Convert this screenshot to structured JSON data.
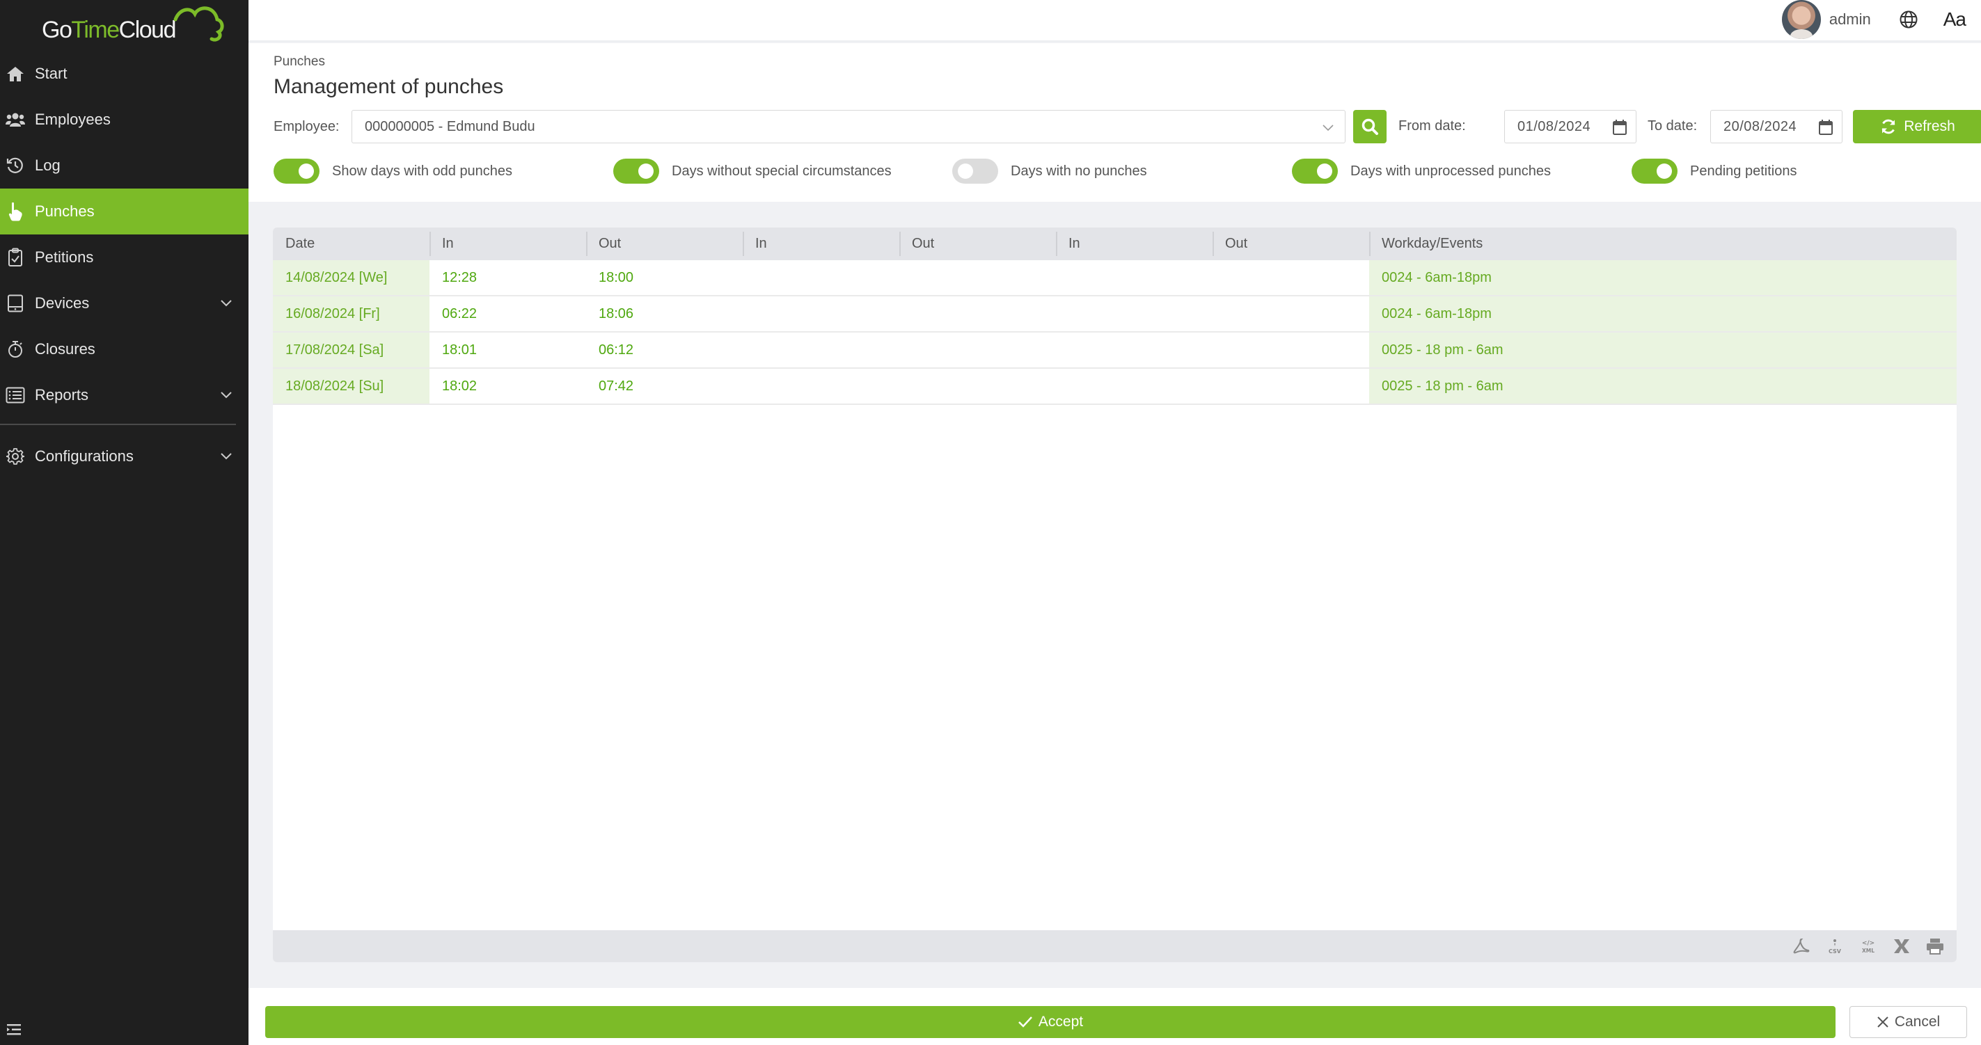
{
  "app": {
    "logo_part1": "Go",
    "logo_part2": "Time",
    "logo_part3": "Cloud",
    "brand_color": "#7cbb28"
  },
  "sidebar": {
    "items": [
      {
        "label": "Start",
        "icon": "home-icon",
        "active": false,
        "expandable": false
      },
      {
        "label": "Employees",
        "icon": "users-icon",
        "active": false,
        "expandable": false
      },
      {
        "label": "Log",
        "icon": "history-icon",
        "active": false,
        "expandable": false
      },
      {
        "label": "Punches",
        "icon": "hand-pointer-icon",
        "active": true,
        "expandable": false
      },
      {
        "label": "Petitions",
        "icon": "clipboard-check-icon",
        "active": false,
        "expandable": false
      },
      {
        "label": "Devices",
        "icon": "tablet-icon",
        "active": false,
        "expandable": true
      },
      {
        "label": "Closures",
        "icon": "stopwatch-icon",
        "active": false,
        "expandable": false
      },
      {
        "label": "Reports",
        "icon": "list-icon",
        "active": false,
        "expandable": true
      },
      {
        "label": "Configurations",
        "icon": "gear-icon",
        "active": false,
        "expandable": true
      }
    ]
  },
  "header": {
    "username": "admin",
    "language_icon": "globe-icon",
    "font_size_label": "Aa"
  },
  "page": {
    "breadcrumb": "Punches",
    "title": "Management of punches"
  },
  "filters": {
    "employee_label": "Employee:",
    "employee_value": "000000005 - Edmund Budu",
    "from_label": "From date:",
    "from_value": "01/08/2024",
    "to_label": "To date:",
    "to_value": "20/08/2024",
    "refresh_label": "Refresh"
  },
  "toggles": [
    {
      "label": "Show days with odd punches",
      "on": true
    },
    {
      "label": "Days without special circumstances",
      "on": true
    },
    {
      "label": "Days with no punches",
      "on": false
    },
    {
      "label": "Days with unprocessed punches",
      "on": true
    },
    {
      "label": "Pending petitions",
      "on": true
    }
  ],
  "table": {
    "columns": [
      "Date",
      "In",
      "Out",
      "In",
      "Out",
      "In",
      "Out",
      "Workday/Events"
    ],
    "rows": [
      [
        "14/08/2024 [We]",
        "12:28",
        "18:00",
        "",
        "",
        "",
        "",
        "0024 - 6am-18pm"
      ],
      [
        "16/08/2024 [Fr]",
        "06:22",
        "18:06",
        "",
        "",
        "",
        "",
        "0024 - 6am-18pm"
      ],
      [
        "17/08/2024 [Sa]",
        "18:01",
        "06:12",
        "",
        "",
        "",
        "",
        "0025 - 18 pm - 6am"
      ],
      [
        "18/08/2024 [Su]",
        "18:02",
        "07:42",
        "",
        "",
        "",
        "",
        "0025 - 18 pm - 6am"
      ]
    ],
    "export_tools": [
      "pdf-export",
      "csv-export",
      "xml-export",
      "excel-export",
      "print"
    ]
  },
  "actions": {
    "accept_label": "Accept",
    "cancel_label": "Cancel"
  }
}
